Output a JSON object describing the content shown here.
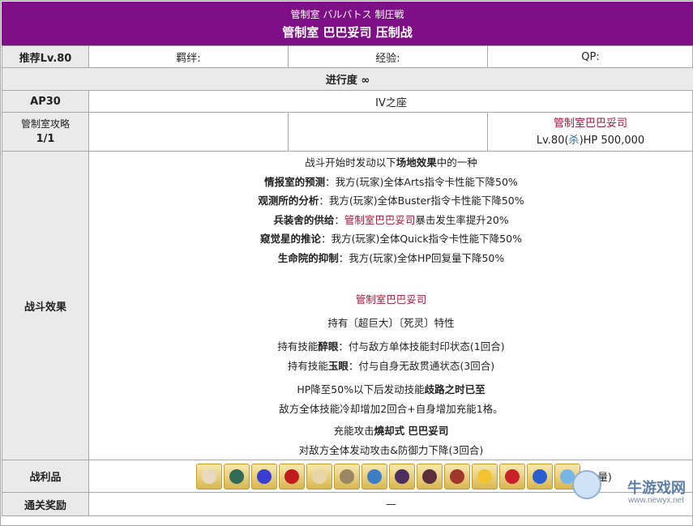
{
  "header": {
    "subtitle": "管制室 バルバトス 制圧戦",
    "title": "管制室 巴巴妥司 压制战"
  },
  "row_level": {
    "label": "推荐Lv.80",
    "bond": "羁绊:",
    "exp": "经验:",
    "qp": "QP:"
  },
  "progress": "进行度 ∞",
  "row_ap": {
    "label": "AP30",
    "place": "IV之座"
  },
  "row_enemy": {
    "label1": "管制室攻略",
    "label2": "1/1",
    "enemy_name": "管制室巴巴妥司",
    "enemy_lv_prefix": "Lv.80(",
    "enemy_class": "杀",
    "enemy_lv_suffix": ")HP 500,000"
  },
  "battle": {
    "label": "战斗效果",
    "intro_pre": "战斗开始时发动以下",
    "intro_bold": "场地效果",
    "intro_post": "中的一种",
    "fields": [
      {
        "name": "情报室的预测",
        "pre": "：我方(玩家)全体Arts指令卡性能下降50%",
        "red": "",
        "post": ""
      },
      {
        "name": "观测所的分析",
        "pre": "：我方(玩家)全体Buster指令卡性能下降50%",
        "red": "",
        "post": ""
      },
      {
        "name": "兵装舍的供给",
        "pre": "：",
        "red": "管制室巴巴妥司",
        "post": "暴击发生率提升20%"
      },
      {
        "name": "窥觉星的推论",
        "pre": "：我方(玩家)全体Quick指令卡性能下降50%",
        "red": "",
        "post": ""
      },
      {
        "name": "生命院的抑制",
        "pre": "：我方(玩家)全体HP回复量下降50%",
        "red": "",
        "post": ""
      }
    ],
    "boss_name": "管制室巴巴妥司",
    "traits": "持有〔超巨大〕〔死灵〕特性",
    "skill1_pre": "持有技能",
    "skill1_name": "醉眼",
    "skill1_post": "：付与敌方单体技能封印状态(1回合)",
    "skill2_pre": "持有技能",
    "skill2_name": "玉眼",
    "skill2_post": "：付与自身无敌贯通状态(3回合)",
    "hp_pre": "HP降至50%以下后发动技能",
    "hp_skill": "歧路之时已至",
    "hp_line2": "敌方全体技能冷却增加2回合+自身增加充能1格。",
    "np_pre": "充能攻击",
    "np_name": "燒却式 巴巴妥司",
    "np_line2": "对敌方全体发动攻击&防御力下降(3回合)"
  },
  "drops": {
    "label": "战利品",
    "items": [
      {
        "icon": "craft-essence-icon",
        "color": "#e8d9c0"
      },
      {
        "icon": "feather-icon",
        "color": "#2f6b55"
      },
      {
        "icon": "blue-gem-icon",
        "color": "#3a3ed0"
      },
      {
        "icon": "red-potion-icon",
        "color": "#c21b1b"
      },
      {
        "icon": "scroll-icon",
        "color": "#e9d6a8"
      },
      {
        "icon": "shell-icon",
        "color": "#9a8663"
      },
      {
        "icon": "lamp-icon",
        "color": "#3c7dc4"
      },
      {
        "icon": "dark-crystal-icon",
        "color": "#4d2f5e"
      },
      {
        "icon": "dark-wing-icon",
        "color": "#5a2e3a"
      },
      {
        "icon": "bone-icon",
        "color": "#a0372a"
      },
      {
        "icon": "gold-star-icon",
        "color": "#f2c230"
      },
      {
        "icon": "red-seal-icon",
        "color": "#c9202a"
      },
      {
        "icon": "blue-orb-icon",
        "color": "#2a5fd0"
      },
      {
        "icon": "crystal-icon",
        "color": "#79b6e8"
      }
    ],
    "note": "(大量)"
  },
  "clear_reward": {
    "label": "通关奖励",
    "value": "—"
  },
  "watermark": {
    "text": "牛游戏网",
    "url": "www.newyx.net"
  }
}
